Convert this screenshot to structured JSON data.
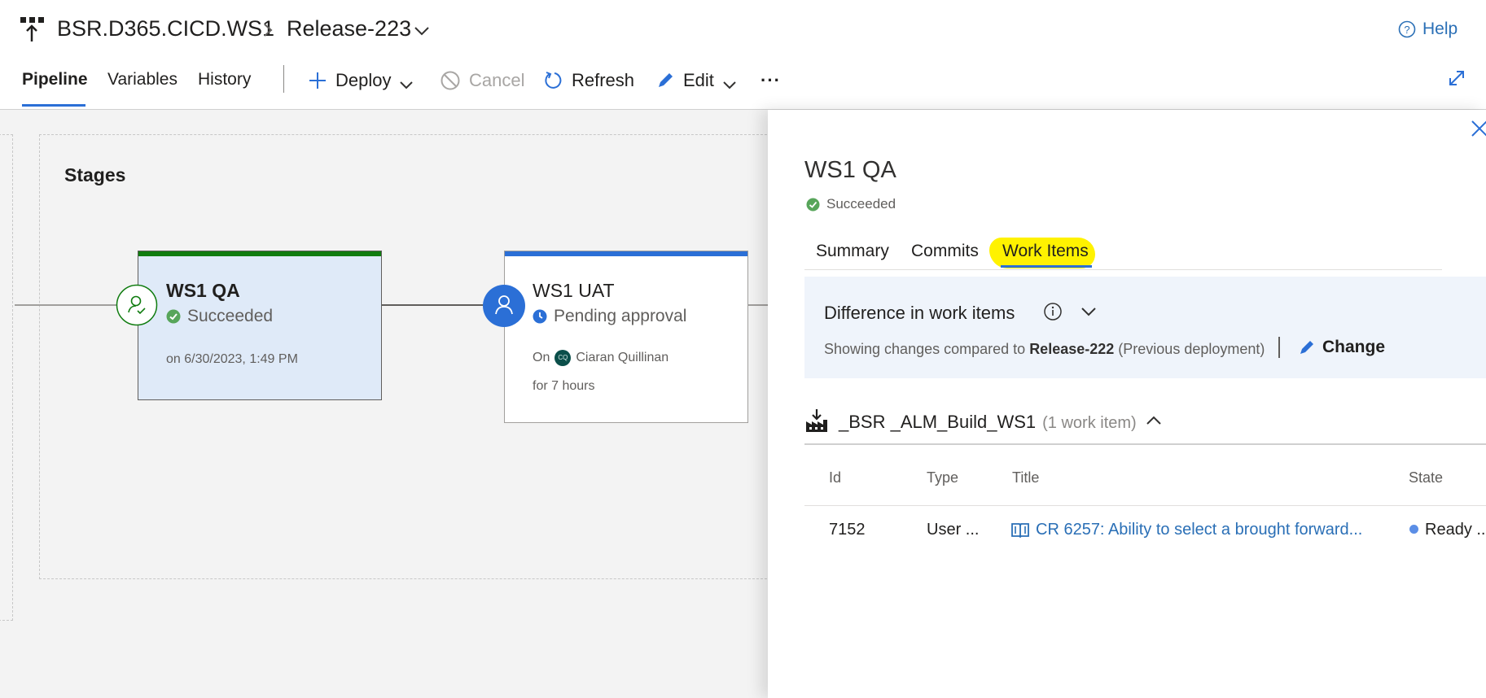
{
  "header": {
    "pipeline_name": "BSR.D365.CICD.WS1",
    "separator": ">",
    "release_name": "Release-223",
    "help_label": "Help"
  },
  "tabs": [
    "Pipeline",
    "Variables",
    "History"
  ],
  "selected_tab": "Pipeline",
  "toolbar": {
    "deploy_label": "Deploy",
    "cancel_label": "Cancel",
    "refresh_label": "Refresh",
    "edit_label": "Edit",
    "more_label": "···"
  },
  "stages_section": {
    "title": "Stages",
    "stages": [
      {
        "name": "WS1 QA",
        "status": "Succeeded",
        "detail": "on 6/30/2023, 1:49 PM",
        "bar_color": "#107c10",
        "status_color": "#57a55a"
      },
      {
        "name": "WS1 UAT",
        "status": "Pending approval",
        "on_label": "On",
        "approver_initials": "CQ",
        "approver": "Ciaran Quillinan",
        "duration": "for 7 hours",
        "bar_color": "#2b6fd6",
        "status_color": "#2b6fd6"
      }
    ]
  },
  "panel": {
    "title": "WS1 QA",
    "status": "Succeeded",
    "tabs": [
      "Summary",
      "Commits",
      "Work Items"
    ],
    "selected_tab": "Work Items",
    "difference": {
      "title": "Difference in work items",
      "prefix": "Showing changes compared to",
      "release": "Release-222",
      "suffix": "(Previous deployment)",
      "change_label": "Change"
    },
    "group": {
      "name": "_BSR _ALM_Build_WS1",
      "count": "(1 work item)"
    },
    "table": {
      "columns": [
        "Id",
        "Type",
        "Title",
        "State"
      ],
      "rows": [
        {
          "id": "7152",
          "type": "User ...",
          "title": "CR 6257: Ability to select a brought forward...",
          "state": "Ready ..."
        }
      ]
    }
  },
  "colors": {
    "accent": "#2b6fd6",
    "success": "#57a55a",
    "link": "#2a6fb6",
    "highlight": "#fff200"
  }
}
